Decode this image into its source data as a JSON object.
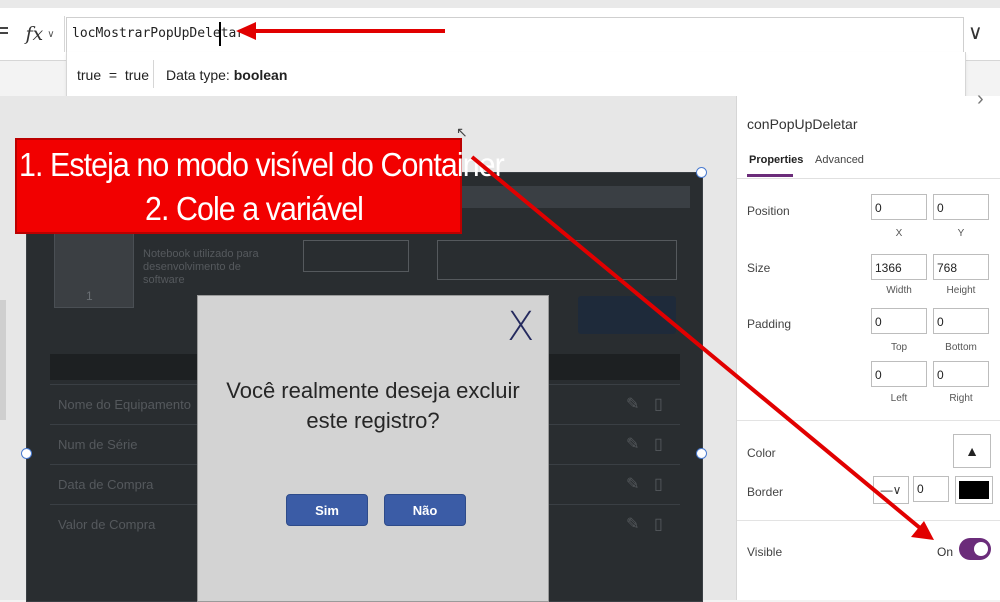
{
  "formula_bar": {
    "fx_label": "fx",
    "formula_text": "locMostrarPopUpDeletar",
    "result_expression": "true  =  true",
    "data_type_label": "Data type:",
    "data_type_value": "boolean"
  },
  "annotation": {
    "line1": "1. Esteja no modo visível do Container",
    "line2": "2. Cole a variável",
    "color": "#f20000"
  },
  "canvas": {
    "thumb_count": "1",
    "product_description": "Notebook utilizado para desenvolvimento de software",
    "table_rows": [
      {
        "label": "Nome do Equipamento"
      },
      {
        "label": "Num de Série"
      },
      {
        "label": "Data de Compra"
      },
      {
        "label": "Valor de Compra"
      }
    ]
  },
  "popup": {
    "question": "Você realmente deseja excluir este registro?",
    "yes_label": "Sim",
    "no_label": "Não",
    "button_color": "#3b5ca6"
  },
  "properties_panel": {
    "control_name": "conPopUpDeletar",
    "tabs": [
      "Properties",
      "Advanced"
    ],
    "active_tab": "Properties",
    "position": {
      "label": "Position",
      "x": "0",
      "y": "0",
      "x_caption": "X",
      "y_caption": "Y"
    },
    "size": {
      "label": "Size",
      "width": "1366",
      "height": "768",
      "width_caption": "Width",
      "height_caption": "Height"
    },
    "padding": {
      "label": "Padding",
      "top": "0",
      "bottom": "0",
      "left": "0",
      "right": "0",
      "top_caption": "Top",
      "bottom_caption": "Bottom",
      "left_caption": "Left",
      "right_caption": "Right"
    },
    "color_label": "Color",
    "border_label": "Border",
    "border_width": "0",
    "border_color": "#000000",
    "visible_label": "Visible",
    "visible_state": "On",
    "toggle_color": "#6b2c7a"
  }
}
